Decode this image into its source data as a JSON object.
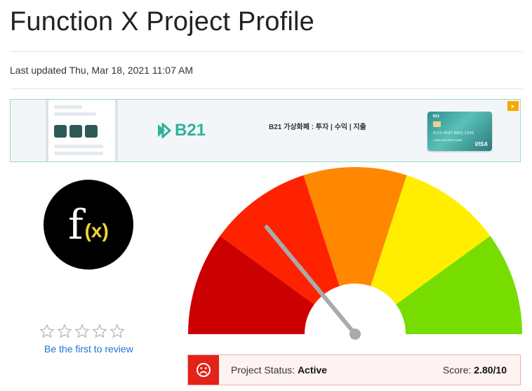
{
  "page": {
    "title": "Function X Project Profile",
    "last_updated": "Last updated Thu, Mar 18, 2021 11:07 AM"
  },
  "banner_ad": {
    "brand": "B21",
    "tagline": "B21 가상화폐 : 투자 | 수익 | 지출",
    "card_brand": "VISA",
    "card_number": "4123 4567 8901 2345",
    "card_holder": "CARD HOLDER NAME",
    "ad_badge_icon": "ad-choices-icon"
  },
  "project": {
    "logo_f": "f",
    "logo_x": "(x)"
  },
  "rating": {
    "stars_total": 5,
    "stars_filled": 0,
    "review_link": "Be the first to review"
  },
  "gauge": {
    "segment_colors": [
      "#cc0000",
      "#ff2200",
      "#ff8800",
      "#ffee00",
      "#77dd00"
    ],
    "needle_score": 2.8,
    "max_score": 10
  },
  "status": {
    "label": "Project Status:",
    "value": "Active",
    "score_label": "Score:",
    "score_value": "2.80/10",
    "icon": "sad-face-icon"
  }
}
